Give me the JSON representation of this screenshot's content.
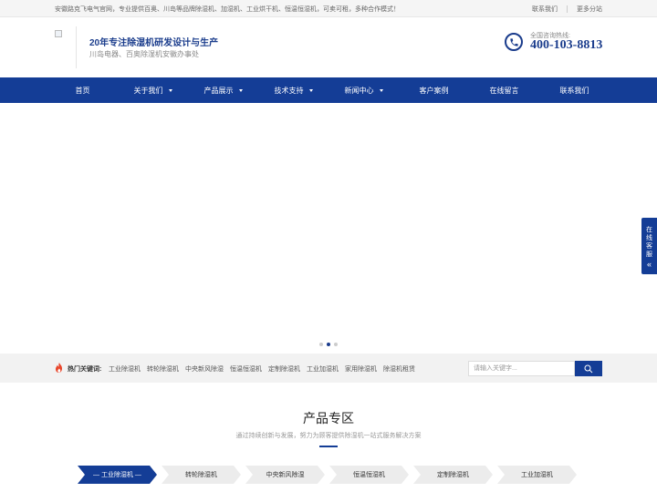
{
  "topbar": {
    "intro": "安徽路克飞电气官网，专业提供百奥、川岛等品牌除湿机、加湿机、工业烘干机、恒温恒湿机，可卖可租，多种合作模式！",
    "links": [
      "联系我们",
      "更多分站"
    ]
  },
  "header": {
    "slogan": "20年专注除湿机研发设计与生产",
    "subslogan": "川岛电器、百奥除湿机安徽办事处",
    "hotline_label": "全国咨询热线:",
    "hotline_number": "400-103-8813"
  },
  "nav": {
    "items": [
      {
        "label": "首页",
        "dropdown": false
      },
      {
        "label": "关于我们",
        "dropdown": true
      },
      {
        "label": "产品展示",
        "dropdown": true
      },
      {
        "label": "技术支持",
        "dropdown": true
      },
      {
        "label": "新闻中心",
        "dropdown": true
      },
      {
        "label": "客户案例",
        "dropdown": false
      },
      {
        "label": "在线留言",
        "dropdown": false
      },
      {
        "label": "联系我们",
        "dropdown": false
      }
    ]
  },
  "banner": {
    "slide_count": 3,
    "active_slide": 2
  },
  "side_service": {
    "label_chars": [
      "在",
      "线",
      "客",
      "服"
    ],
    "chevron": "«"
  },
  "hotbar": {
    "label": "热门关键词:",
    "keywords": [
      "工业除湿机",
      "转轮除湿机",
      "中央新风除湿",
      "恒温恒湿机",
      "定制除湿机",
      "工业加湿机",
      "家用除湿机",
      "除湿机租赁"
    ],
    "search_placeholder": "请输入关键字..."
  },
  "products": {
    "title": "产品专区",
    "subtitle": "通过持续创新与发展，努力为顾客提供除湿机一站式服务解决方案",
    "tabs": [
      "— 工业除湿机 —",
      "转轮除湿机",
      "中央新风除湿",
      "恒温恒湿机",
      "定制除湿机",
      "工业加湿机"
    ],
    "active_tab": 0
  },
  "colors": {
    "brand": "#143d96",
    "accent_fire": "#e8462b"
  }
}
